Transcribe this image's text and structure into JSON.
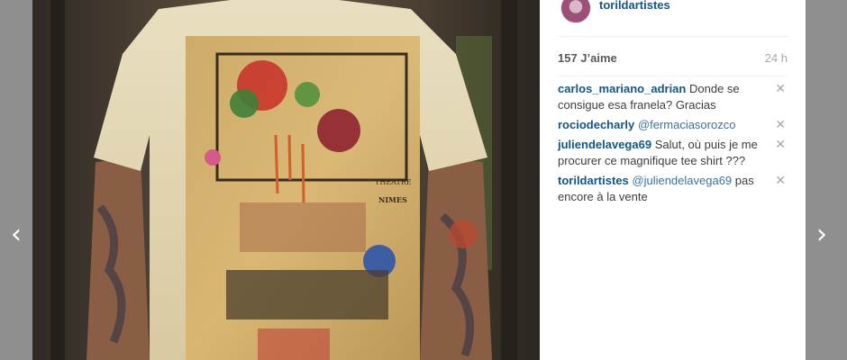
{
  "navigation": {
    "prev_icon": "‹",
    "next_icon": "›"
  },
  "post": {
    "author": "torildartistes",
    "likes": "157 J’aime",
    "age": "24 h"
  },
  "comments": [
    {
      "user": "carlos_mariano_adrian",
      "text": "Donde se consigue esa franela? Gracias",
      "mention": "",
      "close": "✕"
    },
    {
      "user": "rociodecharly",
      "text": "",
      "mention": "@fermaciasorozco",
      "close": "✕"
    },
    {
      "user": "juliendelavega69",
      "text": "Salut, où puis je me procurer ce magnifique tee shirt ???",
      "mention": "",
      "close": "✕"
    },
    {
      "user": "torildartistes",
      "text": "pas encore à la vente",
      "mention": "@juliendelavega69",
      "close": "✕"
    }
  ],
  "photo": {
    "print_text_line1": "THEATRE",
    "print_text_line2": "NIMES"
  },
  "colors": {
    "link": "#125688",
    "mention": "#3f729b",
    "muted": "#a5a7aa",
    "backdrop": "#8f8f8f"
  }
}
